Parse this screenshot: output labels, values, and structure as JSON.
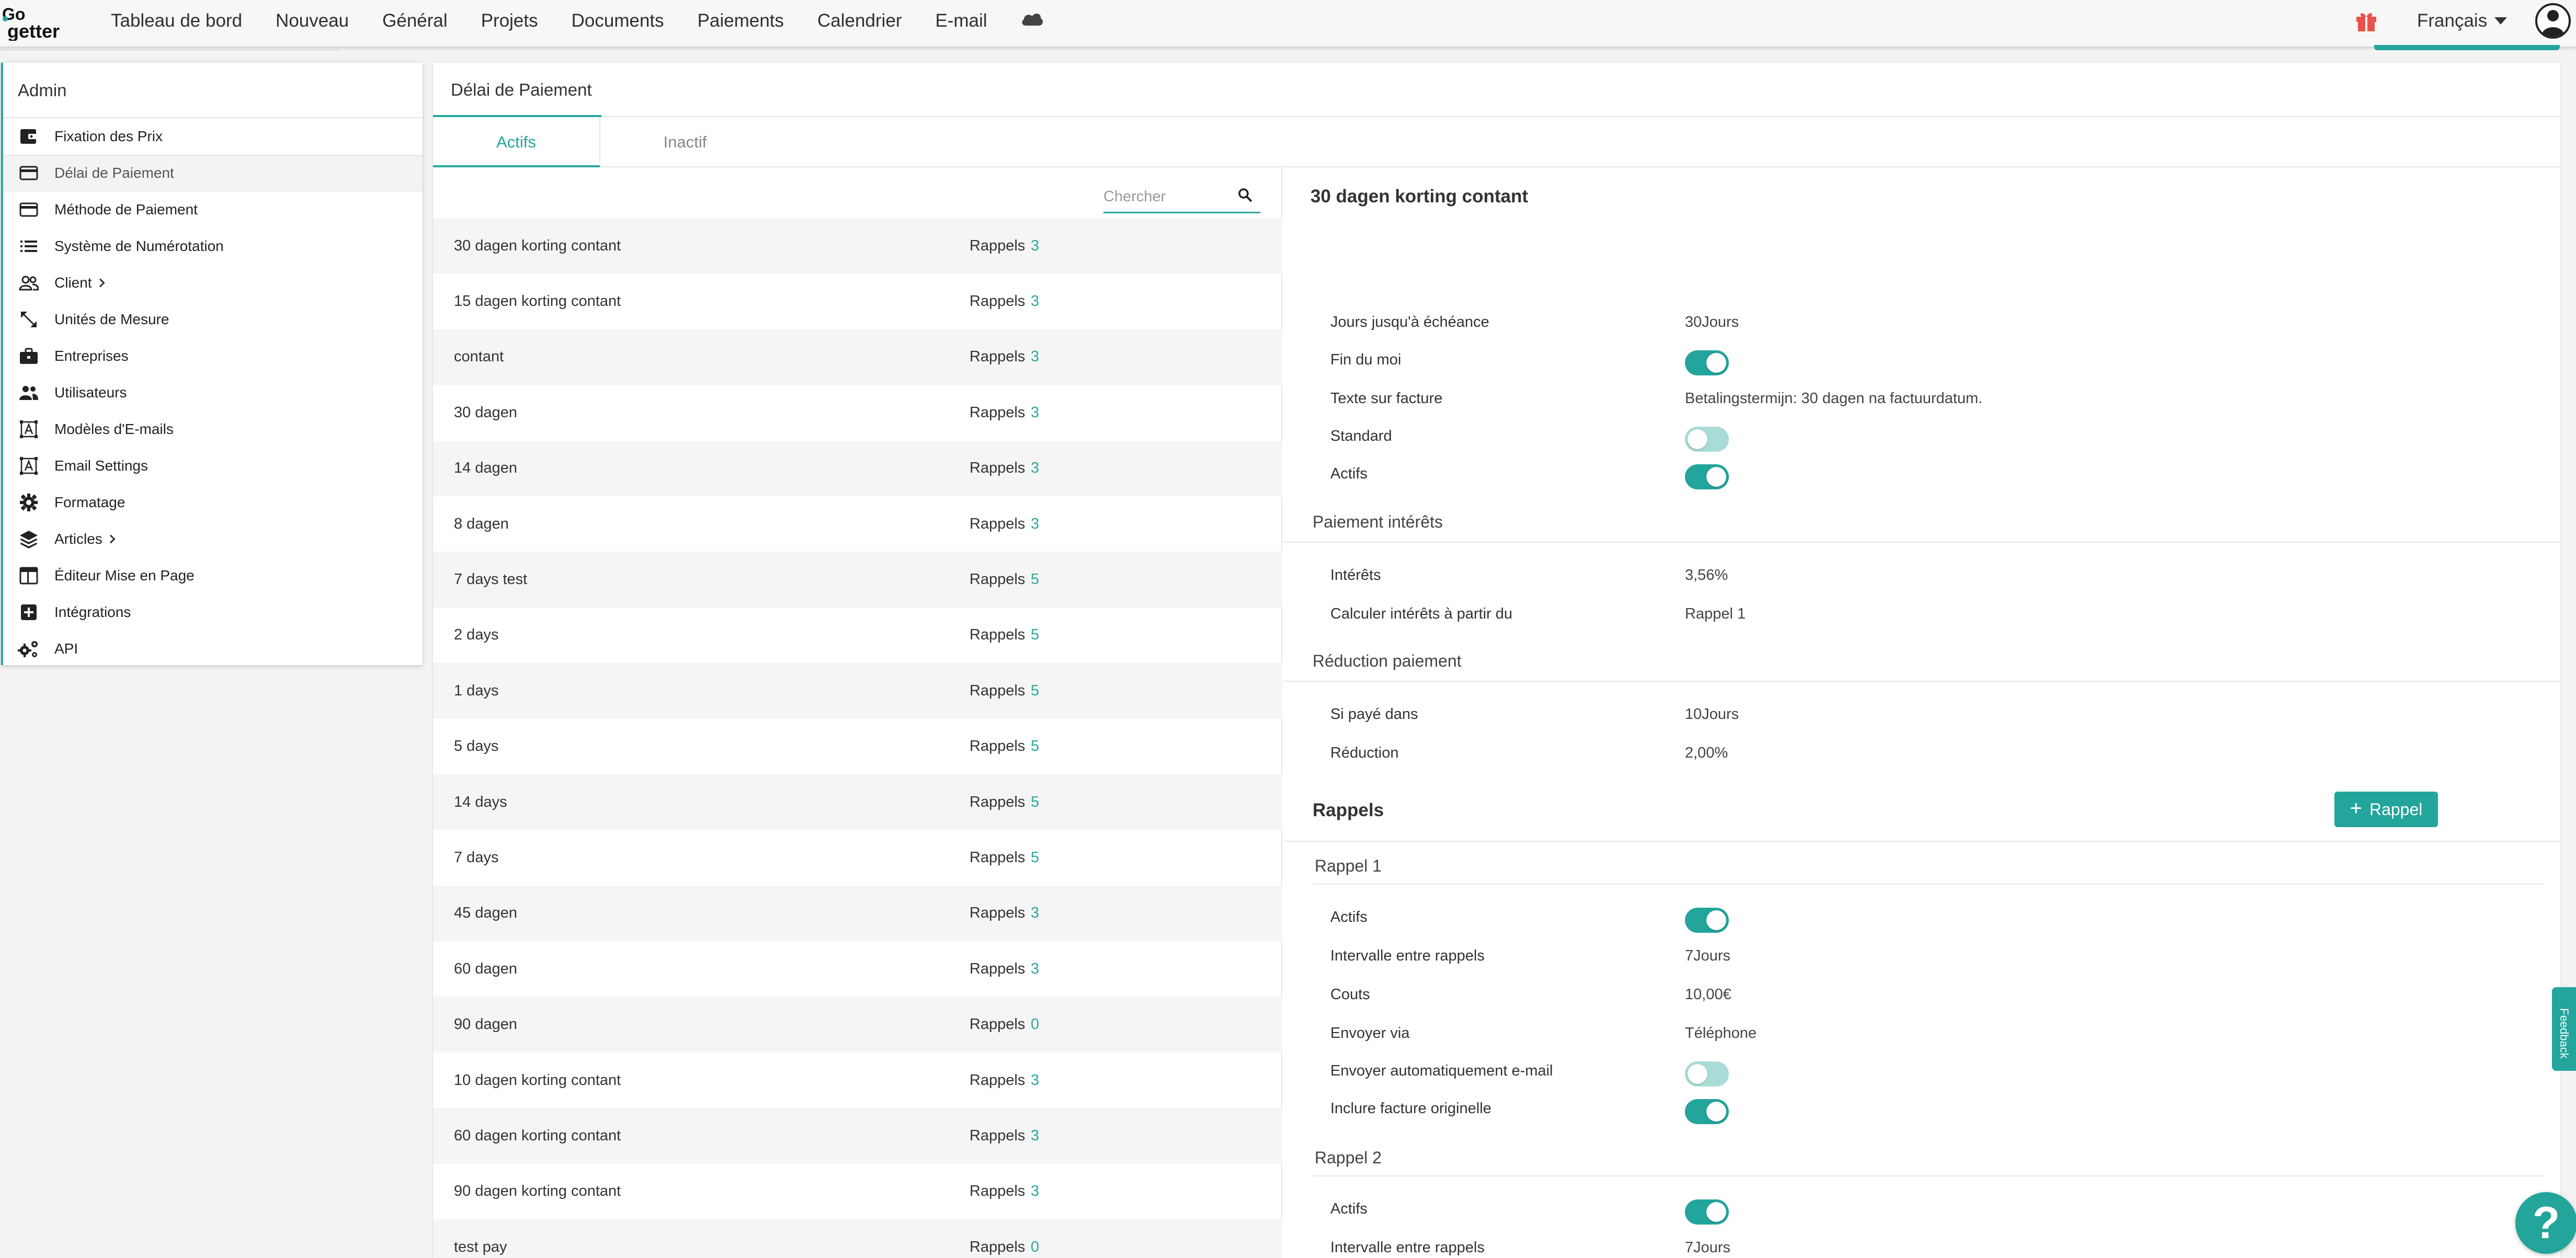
{
  "header": {
    "logo_text": "GoGetter",
    "nav": [
      "Tableau de bord",
      "Nouveau",
      "Général",
      "Projets",
      "Documents",
      "Paiements",
      "Calendrier",
      "E-mail"
    ],
    "language": "Français"
  },
  "sidebar": {
    "title": "Admin",
    "items": [
      {
        "label": "Fixation des Prix",
        "icon": "wallet-icon"
      },
      {
        "label": "Délai de Paiement",
        "icon": "credit-card-icon"
      },
      {
        "label": "Méthode de Paiement",
        "icon": "credit-card-icon"
      },
      {
        "label": "Système de Numérotation",
        "icon": "list-icon"
      },
      {
        "label": "Client",
        "icon": "users-outline-icon"
      },
      {
        "label": "Unités de Mesure",
        "icon": "resize-arrows-icon"
      },
      {
        "label": "Entreprises",
        "icon": "briefcase-icon"
      },
      {
        "label": "Utilisateurs",
        "icon": "users-icon"
      },
      {
        "label": "Modèles d'E-mails",
        "icon": "text-frame-icon"
      },
      {
        "label": "Email Settings",
        "icon": "text-frame-icon"
      },
      {
        "label": "Formatage",
        "icon": "gear-icon"
      },
      {
        "label": "Articles",
        "icon": "layers-icon"
      },
      {
        "label": "Éditeur Mise en Page",
        "icon": "layout-icon"
      },
      {
        "label": "Intégrations",
        "icon": "plus-square-icon"
      },
      {
        "label": "API",
        "icon": "gears-icon"
      }
    ]
  },
  "main": {
    "tab": "Délai de Paiement",
    "subtabs": {
      "active": "Actifs",
      "inactive": "Inactif"
    },
    "search_placeholder": "Chercher"
  },
  "list": {
    "reminder_label": "Rappels",
    "rows": [
      {
        "name": "30 dagen korting contant",
        "count": "3"
      },
      {
        "name": "15 dagen korting contant",
        "count": "3"
      },
      {
        "name": "contant",
        "count": "3"
      },
      {
        "name": "30 dagen",
        "count": "3"
      },
      {
        "name": "14 dagen",
        "count": "3"
      },
      {
        "name": "8 dagen",
        "count": "3"
      },
      {
        "name": "7 days test",
        "count": "5"
      },
      {
        "name": "2 days",
        "count": "5"
      },
      {
        "name": "1 days",
        "count": "5"
      },
      {
        "name": "5 days",
        "count": "5"
      },
      {
        "name": "14 days",
        "count": "5"
      },
      {
        "name": "7 days",
        "count": "5"
      },
      {
        "name": "45 dagen",
        "count": "3"
      },
      {
        "name": "60 dagen",
        "count": "3"
      },
      {
        "name": "90 dagen",
        "count": "0"
      },
      {
        "name": "10 dagen korting contant",
        "count": "3"
      },
      {
        "name": "60 dagen korting contant",
        "count": "3"
      },
      {
        "name": "90 dagen korting contant",
        "count": "3"
      },
      {
        "name": "test pay",
        "count": "0"
      }
    ]
  },
  "detail": {
    "title": "30 dagen korting contant",
    "jours_label": "Jours jusqu'à échéance",
    "jours_value": "30Jours",
    "fin_du_moi_label": "Fin du moi",
    "fin_du_moi_on": true,
    "texte_label": "Texte sur facture",
    "texte_value": "Betalingstermijn: 30 dagen na factuurdatum.",
    "standard_label": "Standard",
    "standard_on": false,
    "actifs_label": "Actifs",
    "actifs_on": true,
    "interest_section": "Paiement intérêts",
    "interets_label": "Intérêts",
    "interets_value": "3,56%",
    "calc_label": "Calculer intérêts à partir du",
    "calc_value": "Rappel 1",
    "reduction_section": "Réduction paiement",
    "si_paye_label": "Si payé dans",
    "si_paye_value": "10Jours",
    "reduction_label": "Réduction",
    "reduction_value": "2,00%",
    "rappels_title": "Rappels",
    "add_button": "Rappel",
    "rappel1": {
      "title": "Rappel 1",
      "actifs_label": "Actifs",
      "actifs_on": true,
      "intervalle_label": "Intervalle entre rappels",
      "intervalle_value": "7Jours",
      "couts_label": "Couts",
      "couts_value": "10,00€",
      "envoyer_via_label": "Envoyer via",
      "envoyer_via_value": "Téléphone",
      "auto_email_label": "Envoyer automatiquement e-mail",
      "auto_email_on": false,
      "inclure_label": "Inclure facture originelle",
      "inclure_on": true
    },
    "rappel2": {
      "title": "Rappel 2",
      "actifs_label": "Actifs",
      "actifs_on": true,
      "intervalle_label": "Intervalle entre rappels",
      "intervalle_value": "7Jours"
    }
  },
  "floating": {
    "feedback": "Feedback",
    "help": "?"
  },
  "colors": {
    "accent": "#23a59b"
  }
}
